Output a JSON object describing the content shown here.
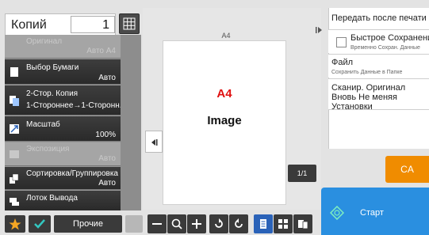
{
  "copies": {
    "label": "Копий",
    "value": "1"
  },
  "functions": [
    {
      "title": "Оригинал",
      "value": "Авто A4",
      "state": "disabled",
      "icon": "original-icon"
    },
    {
      "title": "Выбор Бумаги",
      "value": "Авто",
      "state": "enabled",
      "icon": "paper-icon"
    },
    {
      "title": "2-Стор. Копия",
      "value": "1-Стороннee→1-Сторонн.",
      "state": "enabled",
      "icon": "duplex-icon"
    },
    {
      "title": "Масштаб",
      "value": "100%",
      "state": "enabled",
      "icon": "scale-icon"
    },
    {
      "title": "Экспозиция",
      "value": "Авто",
      "state": "disabled",
      "icon": "exposure-icon"
    },
    {
      "title": "Сортировка/Группировка",
      "value": "Авто",
      "state": "enabled",
      "icon": "sort-icon"
    },
    {
      "title": "Лоток Вывода",
      "value": "",
      "state": "enabled",
      "icon": "output-tray-icon"
    }
  ],
  "bottom_left": {
    "other_label": "Прочие"
  },
  "preview": {
    "paper_size": "A4",
    "paper_red_text": "A4",
    "paper_image_text": "Image",
    "page_counter": "1/1"
  },
  "right_panel": {
    "header": "Передать после печати",
    "items": [
      {
        "title": "Быстрое Сохранение",
        "subtitle": "Временно Сохран. Данные"
      },
      {
        "title": "Файл",
        "subtitle": "Сохранить Данные в Папке"
      },
      {
        "title": "Сканир. Оригинал Вновь Не меняя Установки",
        "subtitle": ""
      }
    ]
  },
  "ca_label": "CA",
  "start_label": "Старт",
  "colors": {
    "accent_orange": "#f08c00",
    "start_blue": "#2a8fe0",
    "warning_red": "#e01010",
    "star_yellow": "#f5a623",
    "check_teal": "#33c7c0"
  }
}
